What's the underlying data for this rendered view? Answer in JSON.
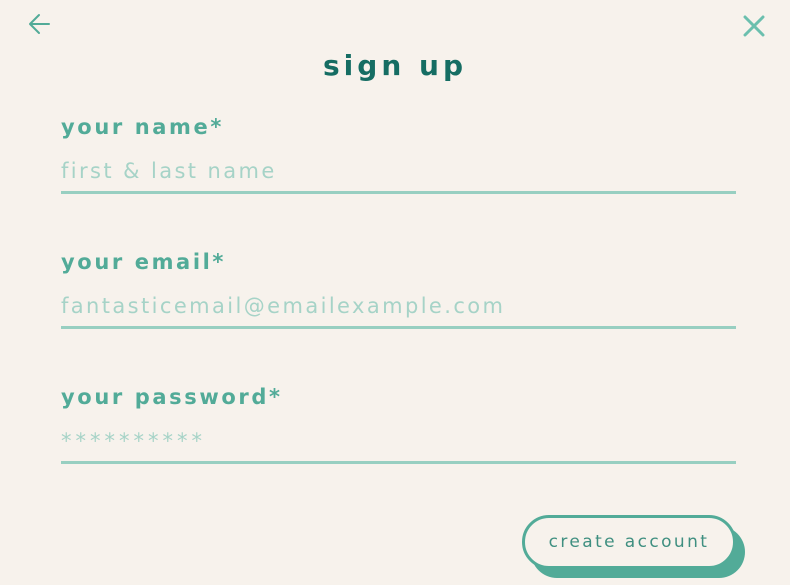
{
  "header": {
    "title": "sign up",
    "back_icon": "arrow-left-icon",
    "close_icon": "close-icon"
  },
  "form": {
    "name": {
      "label": "your name*",
      "placeholder": "first & last name",
      "value": ""
    },
    "email": {
      "label": "your email*",
      "placeholder": "fantasticemail@emailexample.com",
      "value": ""
    },
    "password": {
      "label": "your password*",
      "placeholder": "**********",
      "value": ""
    },
    "submit_label": "create account"
  },
  "colors": {
    "background": "#f7f2ec",
    "title": "#156d63",
    "accent": "#52ab98",
    "placeholder": "#a6d3c7",
    "underline": "#98cfc1"
  }
}
